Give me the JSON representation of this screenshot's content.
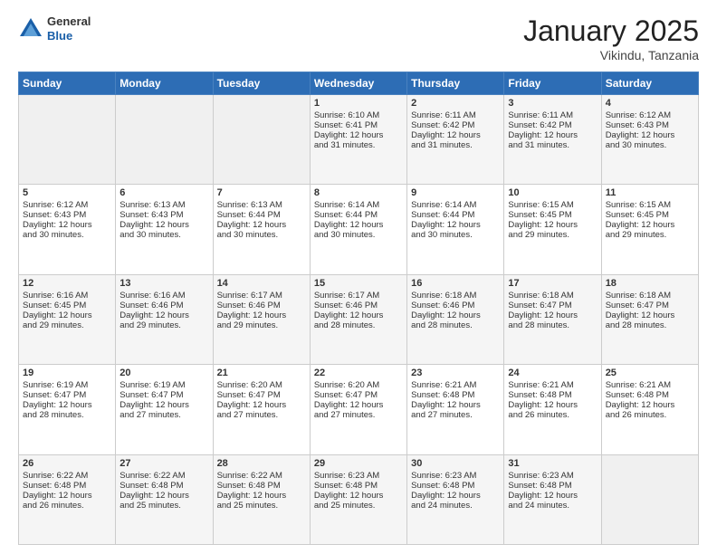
{
  "logo": {
    "general": "General",
    "blue": "Blue"
  },
  "header": {
    "title": "January 2025",
    "location": "Vikindu, Tanzania"
  },
  "weekdays": [
    "Sunday",
    "Monday",
    "Tuesday",
    "Wednesday",
    "Thursday",
    "Friday",
    "Saturday"
  ],
  "weeks": [
    [
      {
        "day": "",
        "info": ""
      },
      {
        "day": "",
        "info": ""
      },
      {
        "day": "",
        "info": ""
      },
      {
        "day": "1",
        "info": "Sunrise: 6:10 AM\nSunset: 6:41 PM\nDaylight: 12 hours\nand 31 minutes."
      },
      {
        "day": "2",
        "info": "Sunrise: 6:11 AM\nSunset: 6:42 PM\nDaylight: 12 hours\nand 31 minutes."
      },
      {
        "day": "3",
        "info": "Sunrise: 6:11 AM\nSunset: 6:42 PM\nDaylight: 12 hours\nand 31 minutes."
      },
      {
        "day": "4",
        "info": "Sunrise: 6:12 AM\nSunset: 6:43 PM\nDaylight: 12 hours\nand 30 minutes."
      }
    ],
    [
      {
        "day": "5",
        "info": "Sunrise: 6:12 AM\nSunset: 6:43 PM\nDaylight: 12 hours\nand 30 minutes."
      },
      {
        "day": "6",
        "info": "Sunrise: 6:13 AM\nSunset: 6:43 PM\nDaylight: 12 hours\nand 30 minutes."
      },
      {
        "day": "7",
        "info": "Sunrise: 6:13 AM\nSunset: 6:44 PM\nDaylight: 12 hours\nand 30 minutes."
      },
      {
        "day": "8",
        "info": "Sunrise: 6:14 AM\nSunset: 6:44 PM\nDaylight: 12 hours\nand 30 minutes."
      },
      {
        "day": "9",
        "info": "Sunrise: 6:14 AM\nSunset: 6:44 PM\nDaylight: 12 hours\nand 30 minutes."
      },
      {
        "day": "10",
        "info": "Sunrise: 6:15 AM\nSunset: 6:45 PM\nDaylight: 12 hours\nand 29 minutes."
      },
      {
        "day": "11",
        "info": "Sunrise: 6:15 AM\nSunset: 6:45 PM\nDaylight: 12 hours\nand 29 minutes."
      }
    ],
    [
      {
        "day": "12",
        "info": "Sunrise: 6:16 AM\nSunset: 6:45 PM\nDaylight: 12 hours\nand 29 minutes."
      },
      {
        "day": "13",
        "info": "Sunrise: 6:16 AM\nSunset: 6:46 PM\nDaylight: 12 hours\nand 29 minutes."
      },
      {
        "day": "14",
        "info": "Sunrise: 6:17 AM\nSunset: 6:46 PM\nDaylight: 12 hours\nand 29 minutes."
      },
      {
        "day": "15",
        "info": "Sunrise: 6:17 AM\nSunset: 6:46 PM\nDaylight: 12 hours\nand 28 minutes."
      },
      {
        "day": "16",
        "info": "Sunrise: 6:18 AM\nSunset: 6:46 PM\nDaylight: 12 hours\nand 28 minutes."
      },
      {
        "day": "17",
        "info": "Sunrise: 6:18 AM\nSunset: 6:47 PM\nDaylight: 12 hours\nand 28 minutes."
      },
      {
        "day": "18",
        "info": "Sunrise: 6:18 AM\nSunset: 6:47 PM\nDaylight: 12 hours\nand 28 minutes."
      }
    ],
    [
      {
        "day": "19",
        "info": "Sunrise: 6:19 AM\nSunset: 6:47 PM\nDaylight: 12 hours\nand 28 minutes."
      },
      {
        "day": "20",
        "info": "Sunrise: 6:19 AM\nSunset: 6:47 PM\nDaylight: 12 hours\nand 27 minutes."
      },
      {
        "day": "21",
        "info": "Sunrise: 6:20 AM\nSunset: 6:47 PM\nDaylight: 12 hours\nand 27 minutes."
      },
      {
        "day": "22",
        "info": "Sunrise: 6:20 AM\nSunset: 6:47 PM\nDaylight: 12 hours\nand 27 minutes."
      },
      {
        "day": "23",
        "info": "Sunrise: 6:21 AM\nSunset: 6:48 PM\nDaylight: 12 hours\nand 27 minutes."
      },
      {
        "day": "24",
        "info": "Sunrise: 6:21 AM\nSunset: 6:48 PM\nDaylight: 12 hours\nand 26 minutes."
      },
      {
        "day": "25",
        "info": "Sunrise: 6:21 AM\nSunset: 6:48 PM\nDaylight: 12 hours\nand 26 minutes."
      }
    ],
    [
      {
        "day": "26",
        "info": "Sunrise: 6:22 AM\nSunset: 6:48 PM\nDaylight: 12 hours\nand 26 minutes."
      },
      {
        "day": "27",
        "info": "Sunrise: 6:22 AM\nSunset: 6:48 PM\nDaylight: 12 hours\nand 25 minutes."
      },
      {
        "day": "28",
        "info": "Sunrise: 6:22 AM\nSunset: 6:48 PM\nDaylight: 12 hours\nand 25 minutes."
      },
      {
        "day": "29",
        "info": "Sunrise: 6:23 AM\nSunset: 6:48 PM\nDaylight: 12 hours\nand 25 minutes."
      },
      {
        "day": "30",
        "info": "Sunrise: 6:23 AM\nSunset: 6:48 PM\nDaylight: 12 hours\nand 24 minutes."
      },
      {
        "day": "31",
        "info": "Sunrise: 6:23 AM\nSunset: 6:48 PM\nDaylight: 12 hours\nand 24 minutes."
      },
      {
        "day": "",
        "info": ""
      }
    ]
  ]
}
